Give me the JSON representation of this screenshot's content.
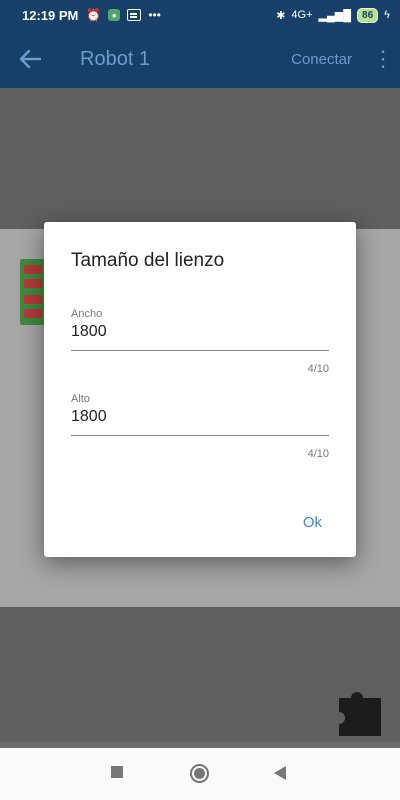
{
  "status_bar": {
    "time": "12:19 PM",
    "icons": [
      "alarm-icon",
      "whatsapp-icon",
      "chat-icon",
      "more-dots-icon"
    ],
    "network": "4G+",
    "battery": "86"
  },
  "app_bar": {
    "title": "Robot 1",
    "connect_label": "Conectar"
  },
  "dialog": {
    "title": "Tamaño del lienzo",
    "fields": [
      {
        "label": "Ancho",
        "value": "1800",
        "counter": "4/10"
      },
      {
        "label": "Alto",
        "value": "1800",
        "counter": "4/10"
      }
    ],
    "ok_label": "Ok"
  },
  "colors": {
    "app_bar": "#14406a",
    "accent": "#3a8ec7",
    "scrim": "#5f5f5f"
  }
}
